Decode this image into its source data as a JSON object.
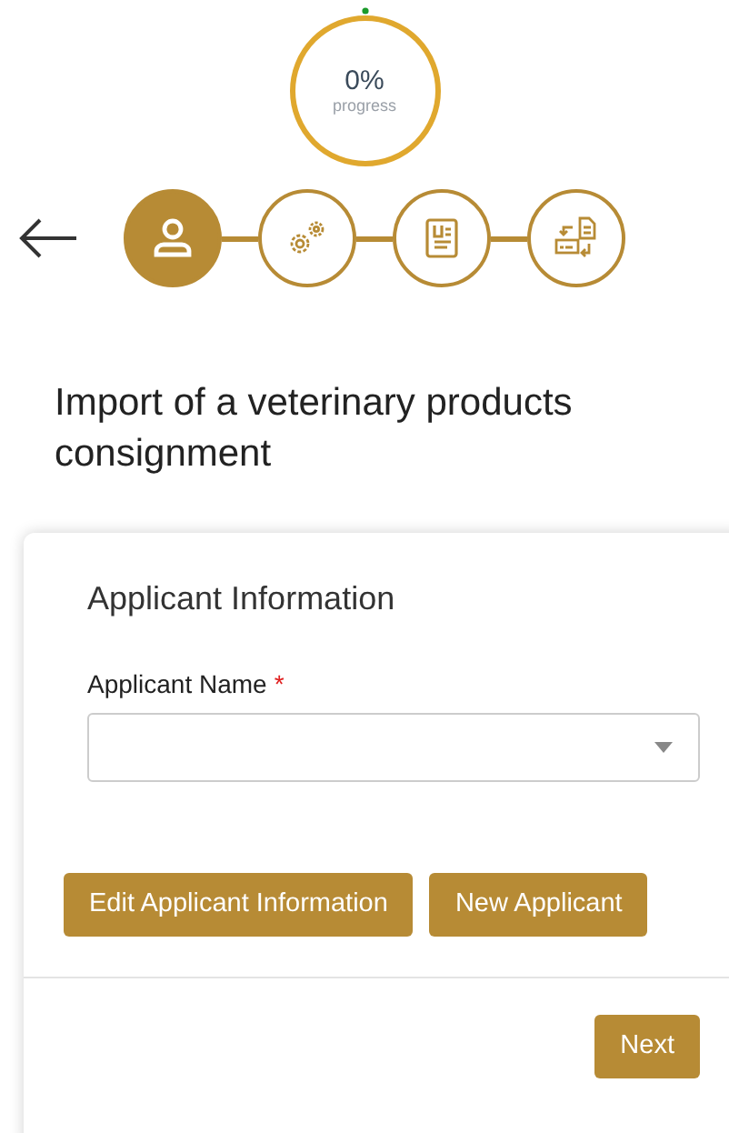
{
  "progress": {
    "value": "0%",
    "label": "progress"
  },
  "steps": [
    {
      "kind": "person",
      "selected": true
    },
    {
      "kind": "gears",
      "selected": false
    },
    {
      "kind": "document",
      "selected": false
    },
    {
      "kind": "exchange",
      "selected": false
    }
  ],
  "title": "Import of a veterinary products consignment",
  "card": {
    "heading": "Applicant Information",
    "field": {
      "label": "Applicant Name",
      "required_mark": "*"
    },
    "buttons": [
      "Edit Applicant Information",
      "New Applicant"
    ],
    "next": "Next"
  }
}
